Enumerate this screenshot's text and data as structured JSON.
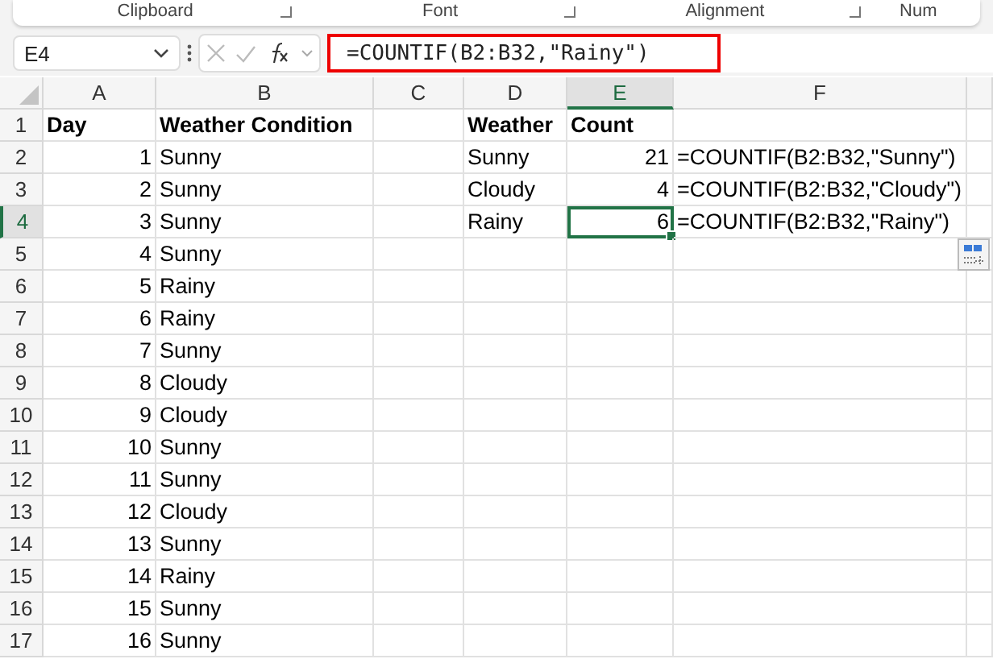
{
  "ribbon": {
    "groups": [
      "Clipboard",
      "Font",
      "Alignment",
      "Num"
    ]
  },
  "formula_bar": {
    "name_box": "E4",
    "formula": "=COUNTIF(B2:B32,\"Rainy\")",
    "highlighted": true
  },
  "grid": {
    "columns": [
      {
        "label": "A",
        "selected": false
      },
      {
        "label": "B",
        "selected": false
      },
      {
        "label": "C",
        "selected": false
      },
      {
        "label": "D",
        "selected": false
      },
      {
        "label": "E",
        "selected": true
      },
      {
        "label": "F",
        "selected": false
      }
    ],
    "rows": [
      {
        "label": "1",
        "selected": false,
        "cells": [
          {
            "text": "Day",
            "kind": "header"
          },
          {
            "text": "Weather Condition",
            "kind": "header"
          },
          {
            "text": "",
            "kind": "text"
          },
          {
            "text": "Weather",
            "kind": "header"
          },
          {
            "text": "Count",
            "kind": "header"
          },
          {
            "text": "",
            "kind": "text"
          }
        ]
      },
      {
        "label": "2",
        "selected": false,
        "cells": [
          {
            "text": "1",
            "kind": "number"
          },
          {
            "text": "Sunny",
            "kind": "text"
          },
          {
            "text": "",
            "kind": "text"
          },
          {
            "text": "Sunny",
            "kind": "text"
          },
          {
            "text": "21",
            "kind": "number"
          },
          {
            "text": "=COUNTIF(B2:B32,\"Sunny\")",
            "kind": "text"
          }
        ]
      },
      {
        "label": "3",
        "selected": false,
        "cells": [
          {
            "text": "2",
            "kind": "number"
          },
          {
            "text": "Sunny",
            "kind": "text"
          },
          {
            "text": "",
            "kind": "text"
          },
          {
            "text": "Cloudy",
            "kind": "text"
          },
          {
            "text": "4",
            "kind": "number"
          },
          {
            "text": "=COUNTIF(B2:B32,\"Cloudy\")",
            "kind": "text"
          }
        ]
      },
      {
        "label": "4",
        "selected": true,
        "cells": [
          {
            "text": "3",
            "kind": "number"
          },
          {
            "text": "Sunny",
            "kind": "text"
          },
          {
            "text": "",
            "kind": "text"
          },
          {
            "text": "Rainy",
            "kind": "text"
          },
          {
            "text": "6",
            "kind": "number"
          },
          {
            "text": "=COUNTIF(B2:B32,\"Rainy\")",
            "kind": "text"
          }
        ]
      },
      {
        "label": "5",
        "selected": false,
        "cells": [
          {
            "text": "4",
            "kind": "number"
          },
          {
            "text": "Sunny",
            "kind": "text"
          }
        ]
      },
      {
        "label": "6",
        "selected": false,
        "cells": [
          {
            "text": "5",
            "kind": "number"
          },
          {
            "text": "Rainy",
            "kind": "text"
          }
        ]
      },
      {
        "label": "7",
        "selected": false,
        "cells": [
          {
            "text": "6",
            "kind": "number"
          },
          {
            "text": "Rainy",
            "kind": "text"
          }
        ]
      },
      {
        "label": "8",
        "selected": false,
        "cells": [
          {
            "text": "7",
            "kind": "number"
          },
          {
            "text": "Sunny",
            "kind": "text"
          }
        ]
      },
      {
        "label": "9",
        "selected": false,
        "cells": [
          {
            "text": "8",
            "kind": "number"
          },
          {
            "text": "Cloudy",
            "kind": "text"
          }
        ]
      },
      {
        "label": "10",
        "selected": false,
        "cells": [
          {
            "text": "9",
            "kind": "number"
          },
          {
            "text": "Cloudy",
            "kind": "text"
          }
        ]
      },
      {
        "label": "11",
        "selected": false,
        "cells": [
          {
            "text": "10",
            "kind": "number"
          },
          {
            "text": "Sunny",
            "kind": "text"
          }
        ]
      },
      {
        "label": "12",
        "selected": false,
        "cells": [
          {
            "text": "11",
            "kind": "number"
          },
          {
            "text": "Sunny",
            "kind": "text"
          }
        ]
      },
      {
        "label": "13",
        "selected": false,
        "cells": [
          {
            "text": "12",
            "kind": "number"
          },
          {
            "text": "Cloudy",
            "kind": "text"
          }
        ]
      },
      {
        "label": "14",
        "selected": false,
        "cells": [
          {
            "text": "13",
            "kind": "number"
          },
          {
            "text": "Sunny",
            "kind": "text"
          }
        ]
      },
      {
        "label": "15",
        "selected": false,
        "cells": [
          {
            "text": "14",
            "kind": "number"
          },
          {
            "text": "Rainy",
            "kind": "text"
          }
        ]
      },
      {
        "label": "16",
        "selected": false,
        "cells": [
          {
            "text": "15",
            "kind": "number"
          },
          {
            "text": "Sunny",
            "kind": "text"
          }
        ]
      },
      {
        "label": "17",
        "selected": false,
        "cells": [
          {
            "text": "16",
            "kind": "number"
          },
          {
            "text": "Sunny",
            "kind": "text"
          }
        ]
      }
    ]
  }
}
